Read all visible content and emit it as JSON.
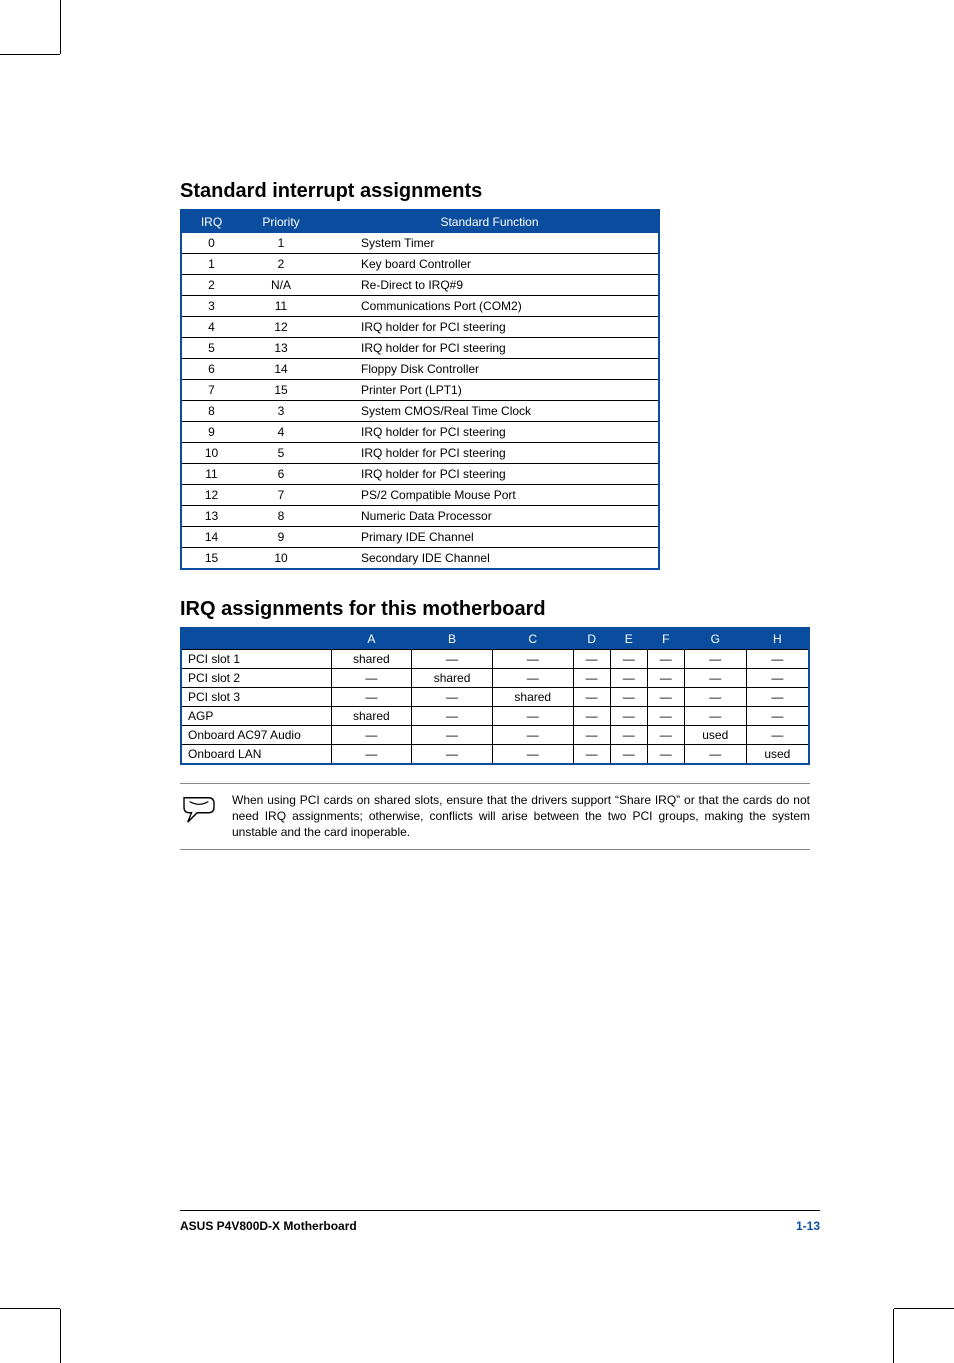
{
  "headings": {
    "section1": "Standard interrupt assignments",
    "section2": "IRQ assignments for this motherboard"
  },
  "table1": {
    "headers": {
      "irq": "IRQ",
      "priority": "Priority",
      "func": "Standard Function"
    },
    "rows": [
      {
        "irq": "0",
        "priority": "1",
        "func": "System Timer"
      },
      {
        "irq": "1",
        "priority": "2",
        "func": "Key board Controller"
      },
      {
        "irq": "2",
        "priority": "N/A",
        "func": "Re-Direct to IRQ#9"
      },
      {
        "irq": "3",
        "priority": "11",
        "func": "Communications Port (COM2)"
      },
      {
        "irq": "4",
        "priority": "12",
        "func": "IRQ holder for PCI steering"
      },
      {
        "irq": "5",
        "priority": "13",
        "func": "IRQ holder for PCI steering"
      },
      {
        "irq": "6",
        "priority": "14",
        "func": "Floppy Disk Controller"
      },
      {
        "irq": "7",
        "priority": "15",
        "func": "Printer Port (LPT1)"
      },
      {
        "irq": "8",
        "priority": "3",
        "func": "System CMOS/Real Time Clock"
      },
      {
        "irq": "9",
        "priority": "4",
        "func": "IRQ holder for PCI steering"
      },
      {
        "irq": "10",
        "priority": "5",
        "func": "IRQ holder for PCI steering"
      },
      {
        "irq": "11",
        "priority": "6",
        "func": "IRQ holder for PCI steering"
      },
      {
        "irq": "12",
        "priority": "7",
        "func": "PS/2 Compatible Mouse Port"
      },
      {
        "irq": "13",
        "priority": "8",
        "func": "Numeric Data Processor"
      },
      {
        "irq": "14",
        "priority": "9",
        "func": "Primary IDE Channel"
      },
      {
        "irq": "15",
        "priority": "10",
        "func": "Secondary IDE Channel"
      }
    ]
  },
  "table2": {
    "headers": [
      "",
      "A",
      "B",
      "C",
      "D",
      "E",
      "F",
      "G",
      "H"
    ],
    "rows": [
      {
        "label": "PCI slot 1",
        "cells": [
          "shared",
          "—",
          "—",
          "—",
          "—",
          "—",
          "—",
          "—"
        ]
      },
      {
        "label": "PCI slot 2",
        "cells": [
          "—",
          "shared",
          "—",
          "—",
          "—",
          "—",
          "—",
          "—"
        ]
      },
      {
        "label": "PCI slot 3",
        "cells": [
          "—",
          "—",
          "shared",
          "—",
          "—",
          "—",
          "—",
          "—"
        ]
      },
      {
        "label": "AGP",
        "cells": [
          "shared",
          "—",
          "—",
          "—",
          "—",
          "—",
          "—",
          "—"
        ]
      },
      {
        "label": "Onboard AC97 Audio",
        "cells": [
          "—",
          "—",
          "—",
          "—",
          "—",
          "—",
          "used",
          "—"
        ]
      },
      {
        "label": "Onboard LAN",
        "cells": [
          "—",
          "—",
          "—",
          "—",
          "—",
          "—",
          "—",
          "used"
        ]
      }
    ]
  },
  "note": {
    "text": "When using PCI cards on shared slots, ensure that the drivers support “Share IRQ” or that the cards do not need IRQ assignments; otherwise, conflicts will arise between the two PCI groups, making the system unstable and the card inoperable."
  },
  "footer": {
    "product": "ASUS P4V800D-X Motherboard",
    "pageno": "1-13"
  }
}
